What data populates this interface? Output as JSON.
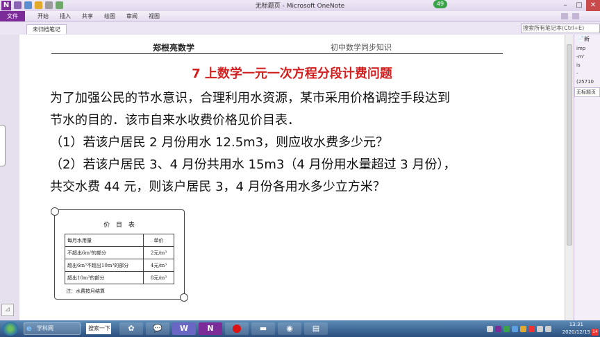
{
  "window": {
    "title": "无标题页 - Microsoft OneNote",
    "badge_count": "49",
    "app_icon": "N"
  },
  "ribbon": {
    "file_tab": "文件",
    "tabs": [
      "开始",
      "插入",
      "共享",
      "绘图",
      "审阅",
      "视图"
    ]
  },
  "notebook": {
    "section_tab": "未归档笔记",
    "search_placeholder": "搜索所有笔记本(Ctrl+E)"
  },
  "page": {
    "header_left": "郑根亮数学",
    "header_right": "初中数学同步知识",
    "title": "7 上数学一元一次方程分段计费问题",
    "problem_lines": [
      "为了加强公民的节水意识，合理利用水资源，某市采用价格调控手段达到",
      "节水的目的．该市自来水收费价格见价目表．",
      "（1）若该户居民 2 月份用水 12.5m3，则应收水费多少元？",
      "（2）若该户居民 3、4 月份共用水 15m3（4 月份用水量超过 3 月份），",
      "共交水费 44 元，则该户居民 3，4 月份各用水多少立方米？"
    ],
    "price_table": {
      "title": "价 目 表",
      "headers": [
        "每月水用量",
        "单价"
      ],
      "rows": [
        [
          "不超出6m³的部分",
          "2元/m³"
        ],
        [
          "超出6m³不超出10m³的部分",
          "4元/m³"
        ],
        [
          "超出10m³的部分",
          "8元/m³"
        ]
      ],
      "note": "注：水费按月结算"
    }
  },
  "right_pane": {
    "new_page": "新",
    "snippets": [
      "imp",
      "-m'",
      "is",
      "-",
      "(25710"
    ],
    "page_item": "无标题页"
  },
  "taskbar": {
    "ie_label": "学科网",
    "search_label": "搜索一下",
    "time": "13:31",
    "date": "2020/12/15",
    "notification_count": "14"
  },
  "colors": {
    "onenote_purple": "#7b2c99",
    "title_red": "#d21f1f"
  }
}
